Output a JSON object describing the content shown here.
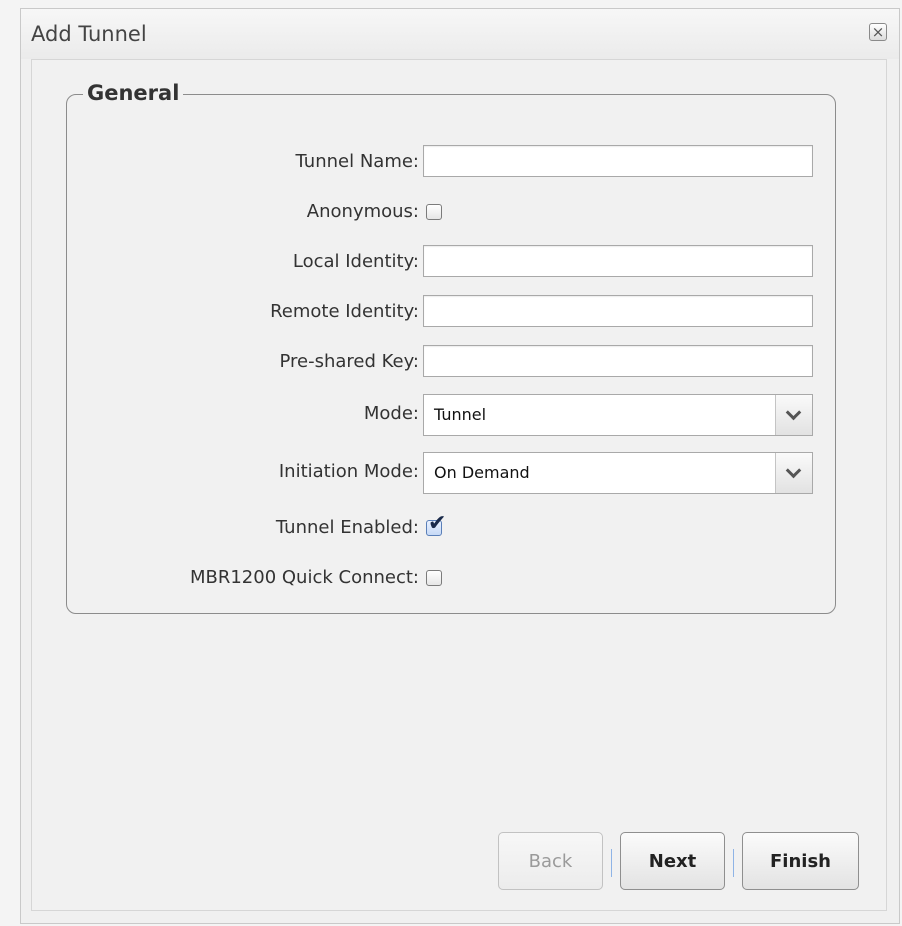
{
  "dialog": {
    "title": "Add Tunnel",
    "close_label": "×"
  },
  "general": {
    "legend": "General",
    "fields": {
      "tunnel_name": {
        "label": "Tunnel Name:",
        "value": ""
      },
      "anonymous": {
        "label": "Anonymous:",
        "checked": false
      },
      "local_identity": {
        "label": "Local Identity:",
        "value": ""
      },
      "remote_identity": {
        "label": "Remote Identity:",
        "value": ""
      },
      "pre_shared_key": {
        "label": "Pre-shared Key:",
        "value": ""
      },
      "mode": {
        "label": "Mode:",
        "value": "Tunnel"
      },
      "initiation_mode": {
        "label": "Initiation Mode:",
        "value": "On Demand"
      },
      "tunnel_enabled": {
        "label": "Tunnel Enabled:",
        "checked": true,
        "mark": "✔"
      },
      "quick_connect": {
        "label": "MBR1200 Quick Connect:",
        "checked": false
      }
    }
  },
  "buttons": {
    "back": "Back",
    "next": "Next",
    "finish": "Finish"
  },
  "colors": {
    "separator": "#8fb4e6",
    "checked_bg": "#c6d9f6"
  }
}
